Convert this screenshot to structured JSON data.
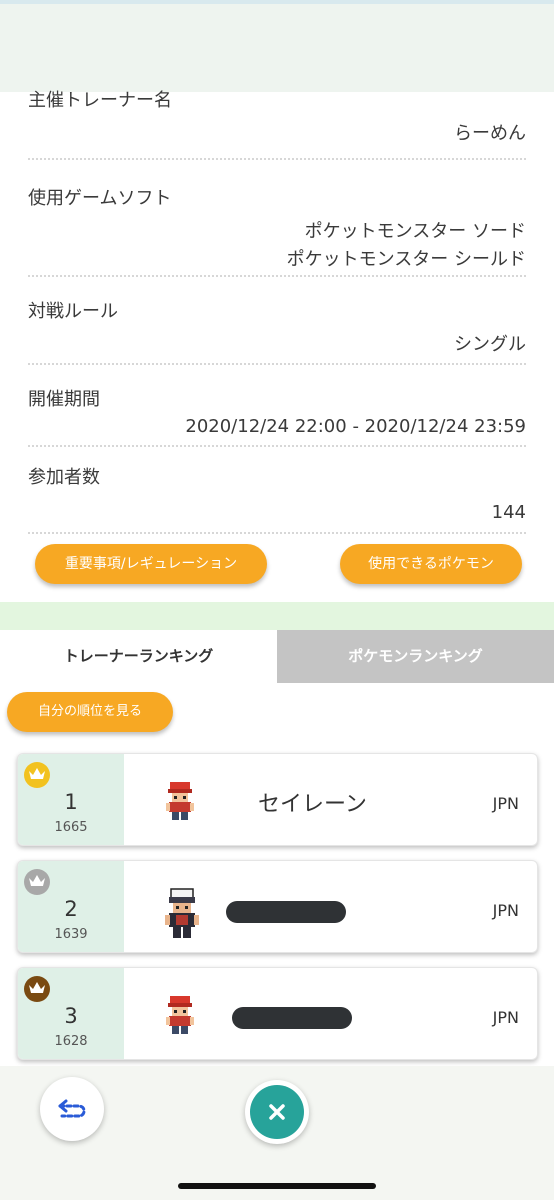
{
  "info": {
    "host_label": "主催トレーナー名",
    "host_value": "らーめん",
    "software_label": "使用ゲームソフト",
    "software_values": [
      "ポケットモンスター ソード",
      "ポケットモンスター シールド"
    ],
    "rule_label": "対戦ルール",
    "rule_value": "シングル",
    "period_label": "開催期間",
    "period_value": "2020/12/24 22:00 - 2020/12/24 23:59",
    "participants_label": "参加者数",
    "participants_value": "144"
  },
  "buttons": {
    "regulation": "重要事項/レギュレーション",
    "usable_pokemon": "使用できるポケモン",
    "my_rank": "自分の順位を見る"
  },
  "tabs": {
    "trainer_ranking": "トレーナーランキング",
    "pokemon_ranking": "ポケモンランキング",
    "active": "trainer_ranking"
  },
  "rankings": [
    {
      "rank": "1",
      "rating": "1665",
      "name": "セイレーン",
      "country": "JPN",
      "crown": "gold-crown-icon"
    },
    {
      "rank": "2",
      "rating": "1639",
      "name": "",
      "country": "JPN",
      "crown": "silver-crown-icon"
    },
    {
      "rank": "3",
      "rating": "1628",
      "name": "",
      "country": "JPN",
      "crown": "bronze-crown-icon"
    }
  ],
  "colors": {
    "accent_orange": "#f7a823",
    "teal": "#27a39a",
    "rank_panel": "#dff0e7",
    "gold": "#f2c21f",
    "silver": "#a8a8a8",
    "bronze": "#7a4a12"
  },
  "nav": {
    "back_icon": "back-arrow-icon",
    "close_icon": "close-icon"
  }
}
